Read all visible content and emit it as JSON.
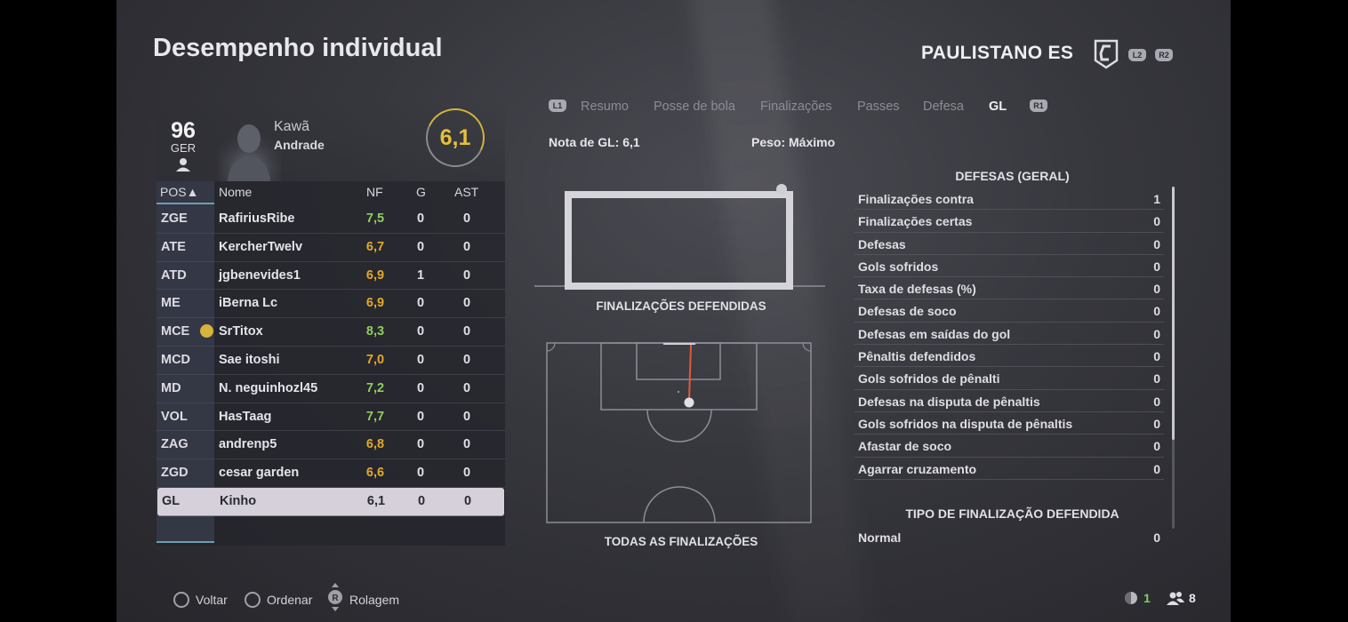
{
  "header": {
    "title": "Desempenho individual",
    "team": "PAULISTANO ES",
    "hints": {
      "l2": "L2",
      "r2": "R2"
    }
  },
  "player": {
    "ovr": "96",
    "nation": "GER",
    "first_name": "Kawã",
    "last_name": "Andrade",
    "rating": "6,1"
  },
  "table": {
    "headers": {
      "pos": "POS▲",
      "name": "Nome",
      "nf": "NF",
      "g": "G",
      "ast": "AST"
    },
    "rows": [
      {
        "pos": "ZGE",
        "name": "RafiriusRibe",
        "nf": "7,5",
        "g": "0",
        "ast": "0",
        "nf_color": "green"
      },
      {
        "pos": "ATE",
        "name": "KercherTwelv",
        "nf": "6,7",
        "g": "0",
        "ast": "0",
        "nf_color": "orange"
      },
      {
        "pos": "ATD",
        "name": "jgbenevides1",
        "nf": "6,9",
        "g": "1",
        "ast": "0",
        "nf_color": "orange"
      },
      {
        "pos": "ME",
        "name": "iBerna Lc",
        "nf": "6,9",
        "g": "0",
        "ast": "0",
        "nf_color": "orange"
      },
      {
        "pos": "MCE",
        "name": "SrTitox",
        "nf": "8,3",
        "g": "0",
        "ast": "0",
        "nf_color": "green",
        "mvp": true
      },
      {
        "pos": "MCD",
        "name": "Sae itoshi",
        "nf": "7,0",
        "g": "0",
        "ast": "0",
        "nf_color": "orange"
      },
      {
        "pos": "MD",
        "name": "N. neguinhozl45",
        "nf": "7,2",
        "g": "0",
        "ast": "0",
        "nf_color": "green"
      },
      {
        "pos": "VOL",
        "name": "HasTaag",
        "nf": "7,7",
        "g": "0",
        "ast": "0",
        "nf_color": "green"
      },
      {
        "pos": "ZAG",
        "name": "andrenp5",
        "nf": "6,8",
        "g": "0",
        "ast": "0",
        "nf_color": "orange"
      },
      {
        "pos": "ZGD",
        "name": "cesar garden",
        "nf": "6,6",
        "g": "0",
        "ast": "0",
        "nf_color": "orange"
      },
      {
        "pos": "GL",
        "name": "Kinho",
        "nf": "6,1",
        "g": "0",
        "ast": "0",
        "nf_color": "plain",
        "selected": true
      }
    ]
  },
  "tabs": {
    "l1": "L1",
    "r1": "R1",
    "items": [
      "Resumo",
      "Posse de bola",
      "Finalizações",
      "Passes",
      "Defesa",
      "GL"
    ],
    "active": "GL"
  },
  "summary": {
    "gk_rating": "Nota de GL: 6,1",
    "weight": "Peso: Máximo"
  },
  "diagrams": {
    "goal_label": "FINALIZAÇÕES DEFENDIDAS",
    "pitch_label": "TODAS AS FINALIZAÇÕES"
  },
  "stats": {
    "title": "DEFESAS (GERAL)",
    "rows": [
      {
        "label": "Finalizações contra",
        "value": "1"
      },
      {
        "label": "Finalizações certas",
        "value": "0"
      },
      {
        "label": "Defesas",
        "value": "0"
      },
      {
        "label": "Gols sofridos",
        "value": "0"
      },
      {
        "label": "Taxa de defesas (%)",
        "value": "0"
      },
      {
        "label": "Defesas de soco",
        "value": "0"
      },
      {
        "label": "Defesas em saídas do gol",
        "value": "0"
      },
      {
        "label": "Pênaltis defendidos",
        "value": "0"
      },
      {
        "label": "Gols sofridos de pênalti",
        "value": "0"
      },
      {
        "label": "Defesas na disputa de pênaltis",
        "value": "0"
      },
      {
        "label": "Gols sofridos na disputa de pênaltis",
        "value": "0"
      },
      {
        "label": "Afastar de soco",
        "value": "0"
      },
      {
        "label": "Agarrar cruzamento",
        "value": "0"
      }
    ],
    "shot_type_title": "TIPO DE FINALIZAÇÃO DEFENDIDA",
    "shot_type_rows": [
      {
        "label": "Normal",
        "value": "0"
      }
    ]
  },
  "footer": {
    "back": "Voltar",
    "sort": "Ordenar",
    "scroll": "Rolagem",
    "stick_letter": "R",
    "online_a": "1",
    "online_b": "8"
  },
  "colors": {
    "rating_gold": "#e6bf3c",
    "nf_green": "#8fcf5a",
    "nf_orange": "#e4a928",
    "accent_blue": "#6a9fb4"
  },
  "icons": [
    "user-icon",
    "team-crest-icon",
    "circle-button-icon",
    "square-button-icon",
    "right-stick-icon",
    "players-icon",
    "controller-icon"
  ]
}
